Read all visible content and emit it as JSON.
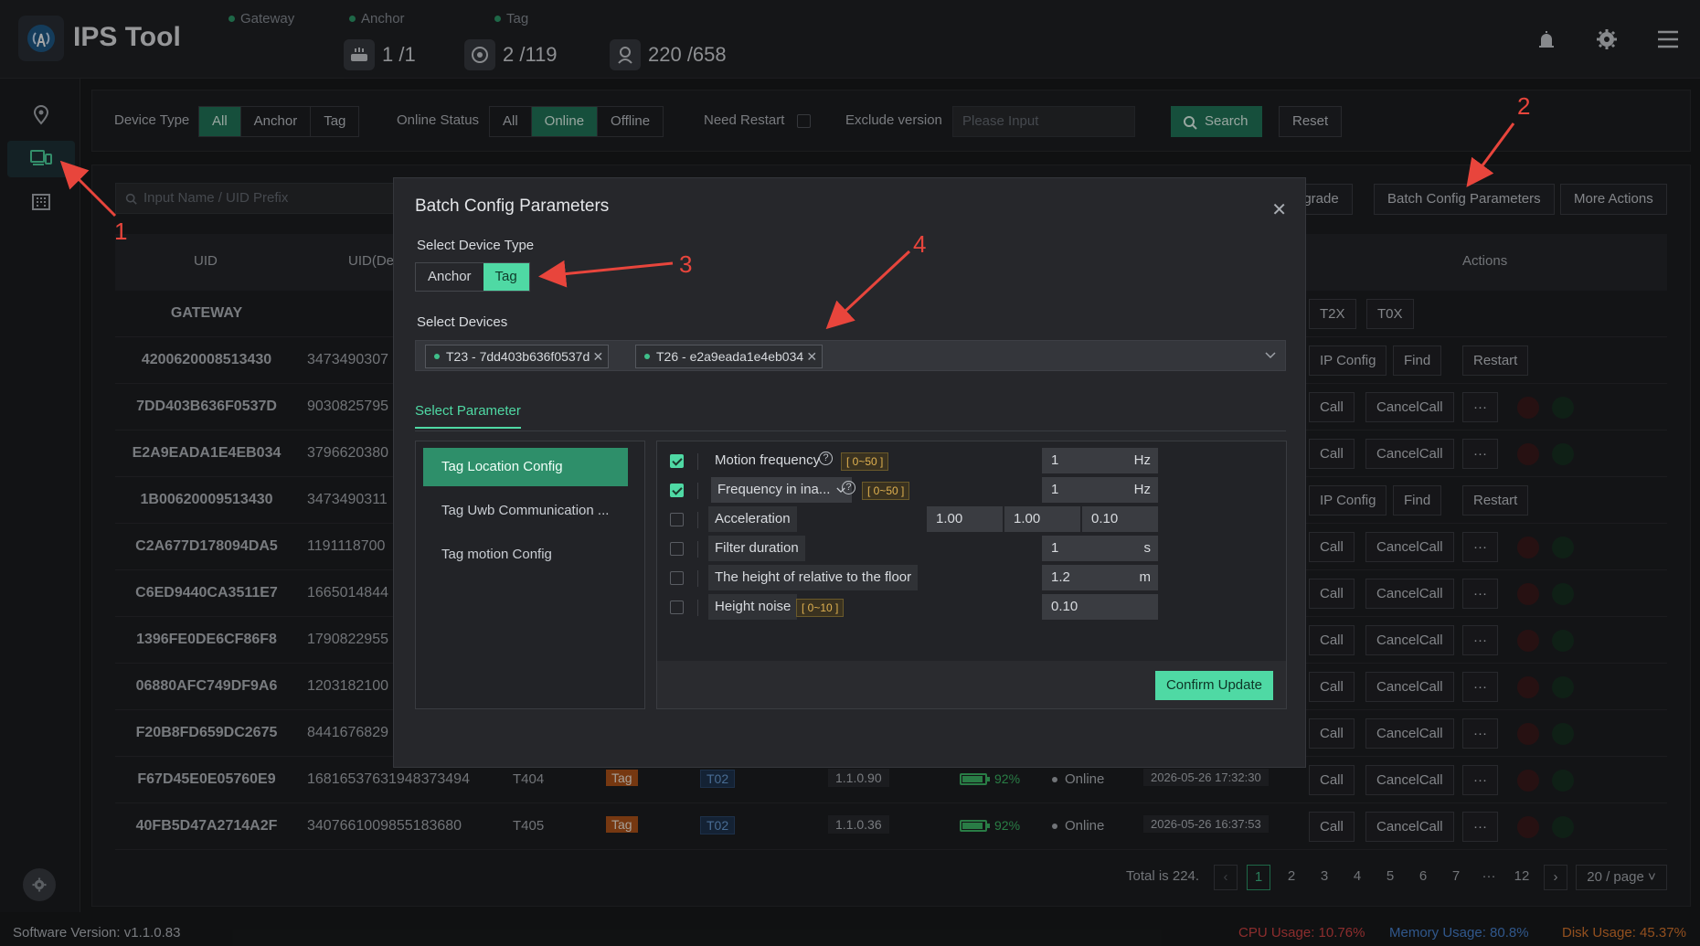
{
  "app": {
    "title": "IPS Tool"
  },
  "stats": [
    {
      "label": "Gateway",
      "value": "1 /1"
    },
    {
      "label": "Anchor",
      "value": "2 /119"
    },
    {
      "label": "Tag",
      "value": "220 /658"
    }
  ],
  "filters": {
    "device_type_label": "Device Type",
    "device_type_options": [
      "All",
      "Anchor",
      "Tag"
    ],
    "online_status_label": "Online Status",
    "online_status_options": [
      "All",
      "Online",
      "Offline"
    ],
    "need_restart_label": "Need Restart",
    "exclude_version_label": "Exclude version",
    "exclude_version_placeholder": "Please Input",
    "search_label": "Search",
    "reset_label": "Reset"
  },
  "toolbar": {
    "search_placeholder": "Input Name / UID Prefix",
    "upgrade_label": "pgrade",
    "batch_config_label": "Batch Config Parameters",
    "more_actions_label": "More Actions"
  },
  "table": {
    "headers": {
      "uid": "UID",
      "uid_dec": "UID(De",
      "actions": "Actions"
    },
    "gateway_row": {
      "uid": "GATEWAY",
      "btn1": "T2X",
      "btn2": "T0X"
    },
    "rows": [
      {
        "uid": "4200620008513430",
        "uid_dec": "3473490307",
        "actions": [
          "IP Config",
          "Find",
          "Restart"
        ]
      },
      {
        "uid": "7DD403B636F0537D",
        "uid_dec": "9030825795",
        "actions": [
          "Call",
          "CancelCall",
          "···"
        ]
      },
      {
        "uid": "E2A9EADA1E4EB034",
        "uid_dec": "3796620380",
        "actions": [
          "Call",
          "CancelCall",
          "···"
        ]
      },
      {
        "uid": "1B00620009513430",
        "uid_dec": "3473490311",
        "actions": [
          "IP Config",
          "Find",
          "Restart"
        ]
      },
      {
        "uid": "C2A677D178094DA5",
        "uid_dec": "1191118700",
        "actions": [
          "Call",
          "CancelCall",
          "···"
        ]
      },
      {
        "uid": "C6ED9440CA3511E7",
        "uid_dec": "1665014844",
        "actions": [
          "Call",
          "CancelCall",
          "···"
        ]
      },
      {
        "uid": "1396FE0DE6CF86F8",
        "uid_dec": "1790822955",
        "actions": [
          "Call",
          "CancelCall",
          "···"
        ]
      },
      {
        "uid": "06880AFC749DF9A6",
        "uid_dec": "1203182100",
        "actions": [
          "Call",
          "CancelCall",
          "···"
        ]
      },
      {
        "uid": "F20B8FD659DC2675",
        "uid_dec": "8441676829",
        "actions": [
          "Call",
          "CancelCall",
          "···"
        ]
      },
      {
        "uid": "F67D45E0E05760E9",
        "uid_dec": "16816537631948373494",
        "name": "T404",
        "type": "Tag",
        "group": "T02",
        "version": "1.1.0.90",
        "battery": "92%",
        "status": "Online",
        "time": "2026-05-26 17:32:30",
        "actions": [
          "Call",
          "CancelCall",
          "···"
        ]
      },
      {
        "uid": "40FB5D47A2714A2F",
        "uid_dec": "3407661009855183680",
        "name": "T405",
        "type": "Tag",
        "group": "T02",
        "version": "1.1.0.36",
        "battery": "92%",
        "status": "Online",
        "time": "2026-05-26 16:37:53",
        "actions": [
          "Call",
          "CancelCall",
          "···"
        ]
      }
    ]
  },
  "pagination": {
    "total": "Total is 224.",
    "pages": [
      "1",
      "2",
      "3",
      "4",
      "5",
      "6",
      "7",
      "···",
      "12"
    ],
    "page_size": "20 / page"
  },
  "footer": {
    "software_version": "Software Version:  v1.1.0.83",
    "cpu": "CPU Usage:  10.76%",
    "memory": "Memory Usage:  80.8%",
    "disk": "Disk Usage:  45.37%"
  },
  "modal": {
    "title": "Batch Config Parameters",
    "select_device_type_label": "Select Device Type",
    "device_types": [
      "Anchor",
      "Tag"
    ],
    "select_devices_label": "Select Devices",
    "selected_devices": [
      "T23 - 7dd403b636f0537d",
      "T26 - e2a9eada1e4eb034"
    ],
    "tab_label": "Select Parameter",
    "config_groups": [
      "Tag Location Config",
      "Tag Uwb Communication ...",
      "Tag motion Config"
    ],
    "params": [
      {
        "name": "Motion frequency",
        "range": "[ 0~50 ]",
        "value": "1",
        "unit": "Hz"
      },
      {
        "name": "Frequency in ina...",
        "range": "[ 0~50 ]",
        "value": "1",
        "unit": "Hz"
      },
      {
        "name": "Acceleration",
        "values": [
          "1.00",
          "1.00",
          "0.10"
        ]
      },
      {
        "name": "Filter duration",
        "value": "1",
        "unit": "s"
      },
      {
        "name": "The height of relative to the floor",
        "value": "1.2",
        "unit": "m"
      },
      {
        "name": "Height noise",
        "range": "[ 0~10 ]",
        "value": "0.10"
      }
    ],
    "confirm_label": "Confirm Update"
  },
  "annotations": [
    "1",
    "2",
    "3",
    "4"
  ],
  "colors": {
    "accent": "#4fd9a4",
    "accent_dark": "#237a5c",
    "annotation": "#e8453c"
  }
}
